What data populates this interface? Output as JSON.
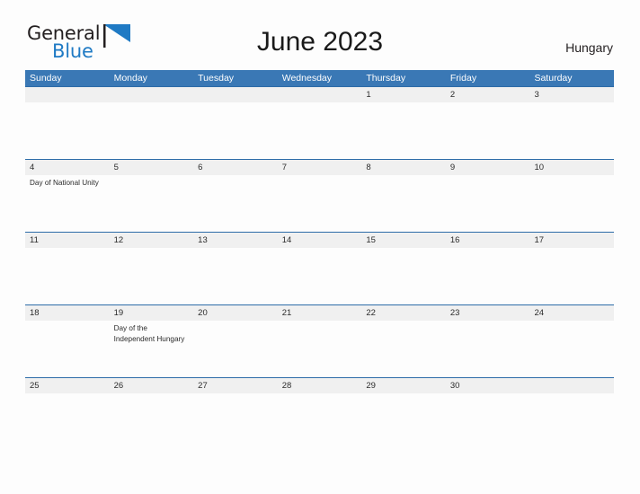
{
  "brand": {
    "name_part1": "General",
    "name_part2": "Blue",
    "flag_icon": "blue-flag-triangle-icon"
  },
  "header": {
    "title": "June 2023",
    "country": "Hungary"
  },
  "calendar": {
    "weekday_headers": [
      "Sunday",
      "Monday",
      "Tuesday",
      "Wednesday",
      "Thursday",
      "Friday",
      "Saturday"
    ],
    "accent_color": "#3a78b5",
    "row_divider_color": "#2d6ca8",
    "number_band_color": "#f0f0f0",
    "weeks": [
      {
        "days": [
          {
            "number": "",
            "event": ""
          },
          {
            "number": "",
            "event": ""
          },
          {
            "number": "",
            "event": ""
          },
          {
            "number": "",
            "event": ""
          },
          {
            "number": "1",
            "event": ""
          },
          {
            "number": "2",
            "event": ""
          },
          {
            "number": "3",
            "event": ""
          }
        ]
      },
      {
        "days": [
          {
            "number": "4",
            "event": "Day of National Unity"
          },
          {
            "number": "5",
            "event": ""
          },
          {
            "number": "6",
            "event": ""
          },
          {
            "number": "7",
            "event": ""
          },
          {
            "number": "8",
            "event": ""
          },
          {
            "number": "9",
            "event": ""
          },
          {
            "number": "10",
            "event": ""
          }
        ]
      },
      {
        "days": [
          {
            "number": "11",
            "event": ""
          },
          {
            "number": "12",
            "event": ""
          },
          {
            "number": "13",
            "event": ""
          },
          {
            "number": "14",
            "event": ""
          },
          {
            "number": "15",
            "event": ""
          },
          {
            "number": "16",
            "event": ""
          },
          {
            "number": "17",
            "event": ""
          }
        ]
      },
      {
        "days": [
          {
            "number": "18",
            "event": ""
          },
          {
            "number": "19",
            "event": "Day of the Independent Hungary"
          },
          {
            "number": "20",
            "event": ""
          },
          {
            "number": "21",
            "event": ""
          },
          {
            "number": "22",
            "event": ""
          },
          {
            "number": "23",
            "event": ""
          },
          {
            "number": "24",
            "event": ""
          }
        ]
      },
      {
        "days": [
          {
            "number": "25",
            "event": ""
          },
          {
            "number": "26",
            "event": ""
          },
          {
            "number": "27",
            "event": ""
          },
          {
            "number": "28",
            "event": ""
          },
          {
            "number": "29",
            "event": ""
          },
          {
            "number": "30",
            "event": ""
          },
          {
            "number": "",
            "event": ""
          }
        ]
      }
    ]
  }
}
